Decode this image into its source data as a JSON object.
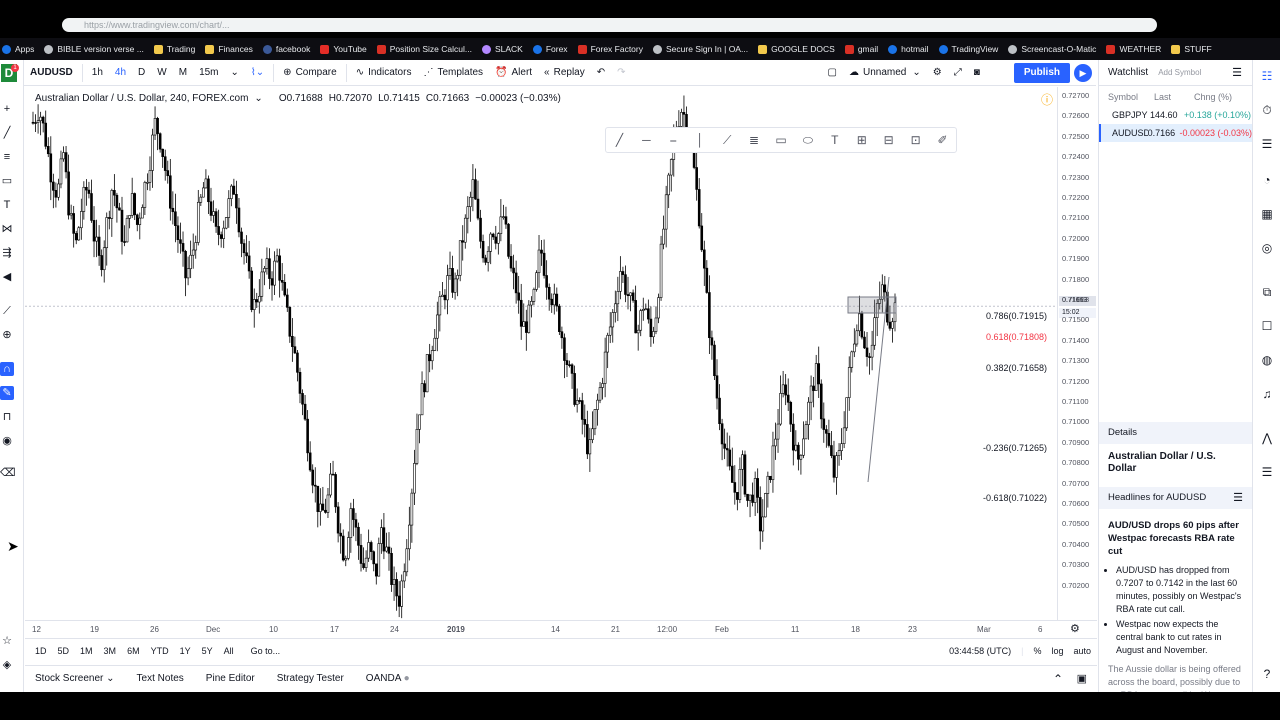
{
  "browser": {
    "url": "https://www.tradingview.com/chart/...",
    "bookmarks": [
      "Apps",
      "BIBLE version verse ...",
      "Trading",
      "Finances",
      "facebook",
      "YouTube",
      "Position Size Calcul...",
      "SLACK",
      "Forex",
      "Forex Factory",
      "Secure Sign In | OA...",
      "GOOGLE DOCS",
      "gmail",
      "hotmail",
      "TradingView",
      "Screencast-O-Matic",
      "WEATHER",
      "STUFF"
    ]
  },
  "toolbar": {
    "symbol": "AUDUSD",
    "intervals": [
      "1h",
      "4h",
      "D",
      "W",
      "M",
      "15m"
    ],
    "compare": "Compare",
    "indicators": "Indicators",
    "templates": "Templates",
    "alert": "Alert",
    "replay": "Replay",
    "layout_name": "Unnamed",
    "publish": "Publish"
  },
  "legend": {
    "instrument": "Australian Dollar / U.S. Dollar, 240, FOREX.com",
    "open": "O0.71688",
    "high": "H0.72070",
    "low": "L0.71415",
    "close": "C0.71663",
    "change": "−0.00023 (−0.03%)"
  },
  "fib_levels": [
    {
      "label": "0.786(0.71915)",
      "color": "#131722"
    },
    {
      "label": "0.618(0.71808)",
      "color": "#f23645"
    },
    {
      "label": "0.382(0.71658)",
      "color": "#131722"
    },
    {
      "label": "-0.236(0.71265)",
      "color": "#131722"
    },
    {
      "label": "-0.618(0.71022)",
      "color": "#131722"
    }
  ],
  "price_ticks": [
    "0.72700",
    "0.72600",
    "0.72500",
    "0.72400",
    "0.72300",
    "0.72200",
    "0.72100",
    "0.72000",
    "0.71900",
    "0.71800",
    "0.71663",
    "0.71500",
    "0.71400",
    "0.71300",
    "0.71200",
    "0.71100",
    "0.71000",
    "0.70900",
    "0.70800",
    "0.70700",
    "0.70600",
    "0.70500",
    "0.70400",
    "0.70300",
    "0.70200"
  ],
  "last_price": {
    "price": "0.71663",
    "countdown": "15:02"
  },
  "time_ticks": [
    "12",
    "19",
    "26",
    "Dec",
    "10",
    "17",
    "24",
    "2019",
    "14",
    "21",
    "12:00",
    "Feb",
    "11",
    "18",
    "23",
    "Mar",
    "6"
  ],
  "range_bar": {
    "ranges": [
      "1D",
      "5D",
      "1M",
      "3M",
      "6M",
      "YTD",
      "1Y",
      "5Y",
      "All"
    ],
    "goto": "Go to...",
    "clock": "03:44:58 (UTC)",
    "percent": "%",
    "log": "log",
    "auto": "auto"
  },
  "bottom_tabs": [
    "Stock Screener",
    "Text Notes",
    "Pine Editor",
    "Strategy Tester",
    "OANDA"
  ],
  "watchlist": {
    "title": "Watchlist",
    "add_symbol": "Add Symbol",
    "columns": [
      "Symbol",
      "Last",
      "Chng (%)"
    ],
    "rows": [
      {
        "symbol": "GBPJPY",
        "last": "144.60",
        "change": "+0.138 (+0.10%)",
        "dir": "pos"
      },
      {
        "symbol": "AUDUSD",
        "last": "0.7166",
        "change": "-0.00023 (-0.03%)",
        "dir": "neg"
      }
    ]
  },
  "details": {
    "header": "Details",
    "name": "Australian Dollar / U.S. Dollar",
    "headlines_header": "Headlines for AUDUSD",
    "news_title": "AUD/USD drops 60 pips after Westpac forecasts RBA rate cut",
    "bullets": [
      "AUD/USD has dropped from 0.7207 to 0.7142 in the last 60 minutes, possibly on Westpac's RBA rate cut call.",
      "Westpac now expects the central bank to cut rates in August and November."
    ],
    "more": "The Aussie dollar is being offered across the board, possibly due to an RBA rate cut call by Westpac."
  },
  "chart_data": {
    "type": "candlestick",
    "symbol": "AUDUSD",
    "timeframe": "240",
    "ylim": [
      0.7015,
      0.7272
    ],
    "candles": [
      0.7255,
      0.7262,
      0.7248,
      0.723,
      0.722,
      0.724,
      0.721,
      0.7195,
      0.7215,
      0.7225,
      0.72,
      0.7185,
      0.7205,
      0.7225,
      0.721,
      0.7195,
      0.722,
      0.7205,
      0.722,
      0.7235,
      0.7255,
      0.7245,
      0.7225,
      0.721,
      0.7195,
      0.718,
      0.719,
      0.721,
      0.7225,
      0.7215,
      0.72,
      0.7205,
      0.7215,
      0.7225,
      0.72,
      0.7185,
      0.7165,
      0.7175,
      0.7185,
      0.718,
      0.719,
      0.717,
      0.7155,
      0.714,
      0.712,
      0.71,
      0.708,
      0.7065,
      0.707,
      0.7085,
      0.706,
      0.7045,
      0.707,
      0.7055,
      0.704,
      0.705,
      0.7035,
      0.706,
      0.7045,
      0.703,
      0.7025,
      0.705,
      0.708,
      0.7115,
      0.713,
      0.7145,
      0.716,
      0.717,
      0.718,
      0.7175,
      0.7195,
      0.721,
      0.7225,
      0.72,
      0.719,
      0.7205,
      0.72,
      0.721,
      0.7185,
      0.7175,
      0.7155,
      0.716,
      0.717,
      0.7195,
      0.718,
      0.717,
      0.716,
      0.7145,
      0.713,
      0.712,
      0.711,
      0.7095,
      0.7115,
      0.713,
      0.715,
      0.7165,
      0.7185,
      0.7175,
      0.7165,
      0.7155,
      0.717,
      0.715,
      0.7165,
      0.72,
      0.7225,
      0.725,
      0.7262,
      0.7255,
      0.7235,
      0.721,
      0.7175,
      0.7145,
      0.712,
      0.71,
      0.7085,
      0.7075,
      0.709,
      0.707,
      0.708,
      0.706,
      0.7075,
      0.7095,
      0.7115,
      0.713,
      0.711,
      0.709,
      0.7105,
      0.712,
      0.7135,
      0.7115,
      0.71,
      0.7085,
      0.7095,
      0.712,
      0.7145,
      0.7165,
      0.715,
      0.714,
      0.7165,
      0.7175,
      0.716,
      0.7166
    ]
  }
}
